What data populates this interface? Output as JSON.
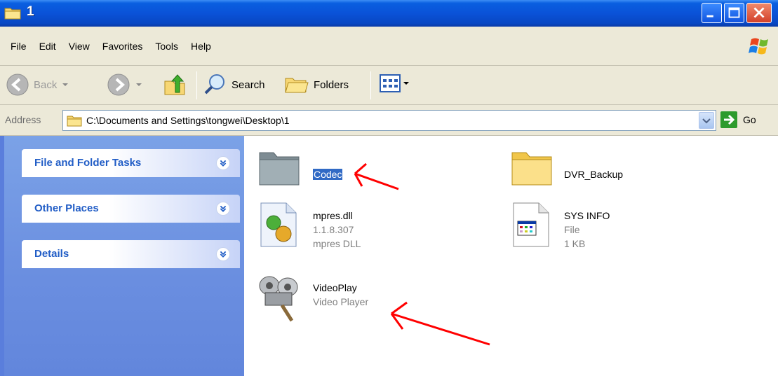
{
  "window": {
    "title": "1"
  },
  "menu": [
    "File",
    "Edit",
    "View",
    "Favorites",
    "Tools",
    "Help"
  ],
  "toolbar": {
    "back": "Back",
    "search": "Search",
    "folders": "Folders"
  },
  "address": {
    "label": "Address",
    "path": "C:\\Documents and Settings\\tongwei\\Desktop\\1",
    "go": "Go"
  },
  "tasks": {
    "file_folder": "File and Folder Tasks",
    "other_places": "Other Places",
    "details": "Details"
  },
  "files": [
    {
      "name": "Codec",
      "type": "folder",
      "selected": true
    },
    {
      "name": "DVR_Backup",
      "type": "folder"
    },
    {
      "name": "mpres.dll",
      "line2": "1.1.8.307",
      "line3": "mpres DLL"
    },
    {
      "name": "SYS INFO",
      "line2": "File",
      "line3": "1 KB"
    },
    {
      "name": "VideoPlay",
      "line2": "Video Player"
    }
  ],
  "colors": {
    "accent": "#0a52d8",
    "selection": "#316ac5",
    "annotation": "#ff0000"
  }
}
